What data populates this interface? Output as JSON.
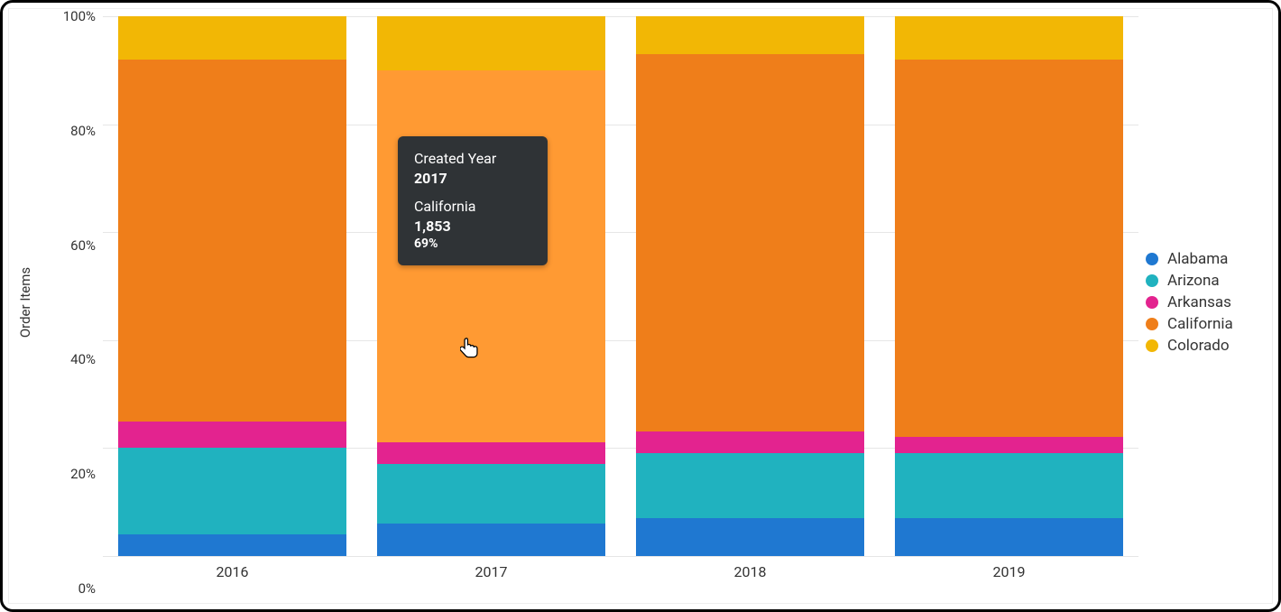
{
  "ylabel": "Order Items",
  "y_ticks": [
    "0%",
    "20%",
    "40%",
    "60%",
    "80%",
    "100%"
  ],
  "legend": [
    {
      "name": "Alabama",
      "color": "#1f78d1"
    },
    {
      "name": "Arizona",
      "color": "#20b2bf"
    },
    {
      "name": "Arkansas",
      "color": "#e3238f"
    },
    {
      "name": "California",
      "color": "#ef7e1a"
    },
    {
      "name": "Colorado",
      "color": "#f2b705"
    }
  ],
  "categories": [
    "2016",
    "2017",
    "2018",
    "2019"
  ],
  "tooltip": {
    "category_label": "Created Year",
    "category_value": "2017",
    "series_label": "California",
    "value": "1,853",
    "percent": "69%"
  },
  "chart_data": {
    "type": "bar",
    "stacking": "100%",
    "categories": [
      "2016",
      "2017",
      "2018",
      "2019"
    ],
    "ylabel": "Order Items",
    "ylim": [
      0,
      100
    ],
    "series": [
      {
        "name": "Alabama",
        "color": "#1f78d1",
        "percent": [
          4,
          6,
          7,
          7
        ]
      },
      {
        "name": "Arizona",
        "color": "#20b2bf",
        "percent": [
          16,
          11,
          12,
          12
        ]
      },
      {
        "name": "Arkansas",
        "color": "#e3238f",
        "percent": [
          5,
          4,
          4,
          3
        ]
      },
      {
        "name": "California",
        "color": "#ef7e1a",
        "percent": [
          67,
          69,
          70,
          70
        ]
      },
      {
        "name": "Colorado",
        "color": "#f2b705",
        "percent": [
          8,
          10,
          7,
          8
        ]
      }
    ],
    "tooltip_sample": {
      "year": "2017",
      "series": "California",
      "value": 1853,
      "percent": 69
    }
  }
}
